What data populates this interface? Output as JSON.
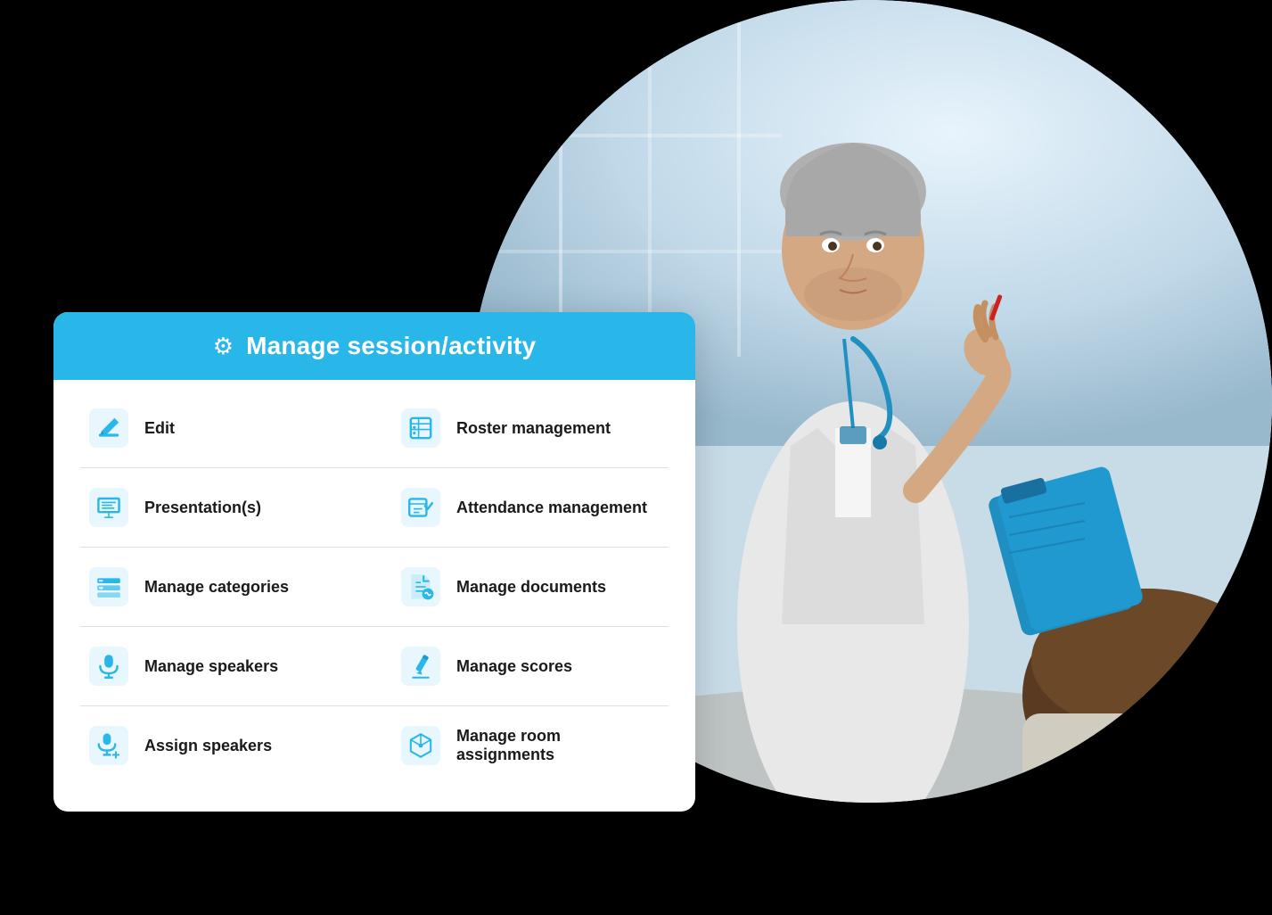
{
  "header": {
    "title": "Manage session/activity",
    "gear_icon": "⚙"
  },
  "menu": {
    "left_col": [
      {
        "id": "edit",
        "label": "Edit",
        "icon": "pencil"
      },
      {
        "id": "presentations",
        "label": "Presentation(s)",
        "icon": "presentation"
      },
      {
        "id": "manage-categories",
        "label": "Manage categories",
        "icon": "categories"
      },
      {
        "id": "manage-speakers",
        "label": "Manage speakers",
        "icon": "microphone"
      },
      {
        "id": "assign-speakers",
        "label": "Assign speakers",
        "icon": "microphone-plus"
      }
    ],
    "right_col": [
      {
        "id": "roster-management",
        "label": "Roster management",
        "icon": "roster"
      },
      {
        "id": "attendance-management",
        "label": "Attendance management",
        "icon": "attendance"
      },
      {
        "id": "manage-documents",
        "label": "Manage documents",
        "icon": "documents"
      },
      {
        "id": "manage-scores",
        "label": "Manage scores",
        "icon": "scores"
      },
      {
        "id": "manage-room-assignments",
        "label": "Manage room assignments",
        "icon": "room"
      }
    ]
  }
}
